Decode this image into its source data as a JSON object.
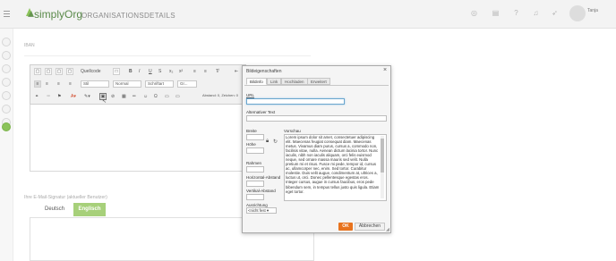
{
  "app": {
    "brand": "simplyOrg",
    "page_title": "ORGANISATIONSDETAILS",
    "user_name": "Tanja"
  },
  "form": {
    "iban_label": "IBAN",
    "signature_label": "Ihre E-Mail-Signatur (aktueller Benutzer)",
    "lang_tabs": [
      "Deutsch",
      "Englisch"
    ],
    "active_lang_index": 1
  },
  "editor_toolbar": {
    "source_label": "Quellcode",
    "style_label": "Stil",
    "format_label": "Normal",
    "font_label": "Schriftart",
    "size_label": "Gr...",
    "spacing_label": "Abstand: 0, Zeichen: 0"
  },
  "dialog": {
    "title": "Bildeigenschaften",
    "close_glyph": "×",
    "tabs": [
      "Bildinfo",
      "Link",
      "Hochladen",
      "Erweitert"
    ],
    "active_tab_index": 0,
    "url_label": "URL",
    "url_value": "",
    "alt_label": "Alternativer Text",
    "alt_value": "",
    "width_label": "Breite",
    "height_label": "Höhe",
    "border_label": "Rahmen",
    "hspace_label": "Horizontal-Abstand",
    "vspace_label": "Vertikal-Abstand",
    "align_label": "Ausrichtung",
    "align_value": "<nicht fest",
    "preview_label": "Vorschau",
    "preview_text": "Lorem ipsum dolor sit amet, consectetuer adipiscing elit. Maecenas feugiat consequat diam. Maecenas metus. Vivamus diam purus, cursus a, commodo non, facilisis vitae, nulla. Aenean dictum lacinia tortor. Nunc iaculis, nibh non iaculis aliquam, orci felis euismod neque, sed ornare massa mauris sed velit. Nulla pretium mi et risus. Fusce mi pede, tempor id, cursus ac, ullamcorper nec, enim. Sed tortor. Curabitur molestie. Duis velit augue, condimentum at, ultrices a, luctus ut, orci. Donec pellentesque egestas eros. Integer cursus, augue in cursus faucibus, eros pede bibendum sem, in tempus tellus justo quis ligula. Etiam eget tortor.",
    "ok_label": "OK",
    "cancel_label": "Abbrechen"
  },
  "colors": {
    "brand_green": "#6aa24a",
    "tab_active": "#a7d07a",
    "ok_orange": "#e8731e"
  }
}
